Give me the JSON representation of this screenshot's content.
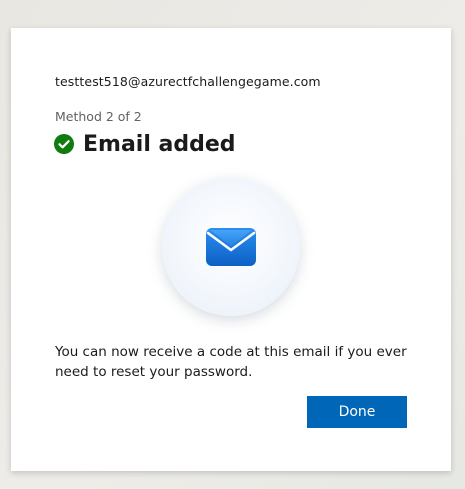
{
  "account": {
    "email": "testtest518@azurectfchallengegame.com"
  },
  "step": {
    "method_label": "Method 2 of 2"
  },
  "header": {
    "title": "Email added",
    "status_icon": "check-circle-icon",
    "status_color": "#107c10"
  },
  "hero": {
    "icon": "mail-icon",
    "icon_color": "#1a7fe0"
  },
  "body": {
    "message": "You can now receive a code at this email if you ever need to reset your password."
  },
  "actions": {
    "done_label": "Done",
    "accent_color": "#0067b8"
  }
}
